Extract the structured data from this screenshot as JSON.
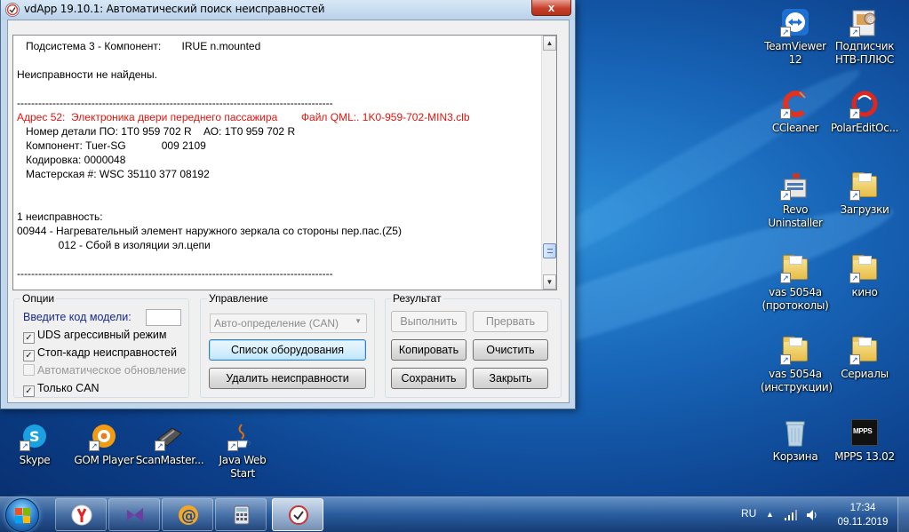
{
  "window": {
    "title": "vdApp 19.10.1: Автоматический поиск неисправностей",
    "close_label": "x"
  },
  "log": {
    "lines": [
      {
        "text": "   Подсистема 3 - Компонент:       IRUE n.mounted",
        "color": "black"
      },
      {
        "text": "",
        "color": "black"
      },
      {
        "text": "Неисправности не найдены.",
        "color": "black"
      },
      {
        "text": "",
        "color": "black"
      },
      {
        "text": "-----------------------------------------------------------------------------------------",
        "color": "black"
      },
      {
        "text": "Адрес 52:  Электроника двери переднего пассажира        Файл QML:. 1K0-959-702-MIN3.clb",
        "color": "red"
      },
      {
        "text": "   Номер детали ПО: 1T0 959 702 R    АО: 1T0 959 702 R",
        "color": "black"
      },
      {
        "text": "   Компонент: Tuer-SG            009 2109",
        "color": "black"
      },
      {
        "text": "   Кодировка: 0000048",
        "color": "black"
      },
      {
        "text": "   Мастерская #: WSC 35110 377 08192",
        "color": "black"
      },
      {
        "text": "",
        "color": "black"
      },
      {
        "text": "",
        "color": "black"
      },
      {
        "text": "1 неисправность:",
        "color": "black"
      },
      {
        "text": "00944 - Нагревательный элемент наружного зеркала со стороны пер.пас.(Z5)",
        "color": "black"
      },
      {
        "text": "              012 - Сбой в изоляции эл.цепи",
        "color": "black"
      },
      {
        "text": "",
        "color": "black"
      },
      {
        "text": "-----------------------------------------------------------------------------------------",
        "color": "black"
      }
    ]
  },
  "options": {
    "title": "Опции",
    "model_code_label": "Введите код модели:",
    "model_code_value": "",
    "checkboxes": [
      {
        "label": "UDS агрессивный режим",
        "checked": true,
        "enabled": true
      },
      {
        "label": "Стоп-кадр неисправностей",
        "checked": true,
        "enabled": true
      },
      {
        "label": "Автоматическое обновление",
        "checked": false,
        "enabled": false
      },
      {
        "label": "Только CAN",
        "checked": true,
        "enabled": true
      }
    ]
  },
  "control": {
    "title": "Управление",
    "mode_select": "Авто-определение (CAN)",
    "equipment_list_button": "Список оборудования",
    "delete_faults_button": "Удалить неисправности"
  },
  "result": {
    "title": "Результат",
    "execute_button": "Выполнить",
    "abort_button": "Прервать",
    "copy_button": "Копировать",
    "clear_button": "Очистить",
    "save_button": "Сохранить",
    "close_button": "Закрыть"
  },
  "desktop_icons": [
    {
      "name": "teamviewer",
      "label": "TeamViewer 12",
      "icon": "teamviewer-icon"
    },
    {
      "name": "podpisnik",
      "label": "Подписчик НТВ-ПЛЮС",
      "icon": "podpisnik-icon"
    },
    {
      "name": "ccleaner",
      "label": "CCleaner",
      "icon": "ccleaner-icon"
    },
    {
      "name": "polaredit",
      "label": "PolarEditOc...",
      "icon": "polaredit-icon"
    },
    {
      "name": "revo",
      "label": "Revo Uninstaller",
      "icon": "revo-icon"
    },
    {
      "name": "downloads",
      "label": "Загрузки",
      "icon": "folder-icon"
    },
    {
      "name": "vas-protocols",
      "label": "vas 5054a (протоколы)",
      "icon": "folder-icon"
    },
    {
      "name": "kino",
      "label": "кино",
      "icon": "folder-icon"
    },
    {
      "name": "vas-instructions",
      "label": "vas 5054a (инструкции)",
      "icon": "folder-icon"
    },
    {
      "name": "serials",
      "label": "Сериалы",
      "icon": "folder-icon"
    },
    {
      "name": "recycle-bin",
      "label": "Корзина",
      "icon": "recycle-bin-icon"
    },
    {
      "name": "mpps",
      "label": "MPPS 13.02",
      "icon": "mpps-icon"
    },
    {
      "name": "skype",
      "label": "Skype",
      "icon": "skype-icon"
    },
    {
      "name": "gom",
      "label": "GOM Player",
      "icon": "gom-player-icon"
    },
    {
      "name": "scanmaster",
      "label": "ScanMaster...",
      "icon": "scanmaster-icon"
    },
    {
      "name": "java",
      "label": "Java Web Start",
      "icon": "java-icon"
    }
  ],
  "mpps_icon_text": "MPPS",
  "taskbar": {
    "language": "RU",
    "time": "17:34",
    "date": "09.11.2019",
    "pinned": [
      "yandex-browser-icon",
      "visual-studio-icon",
      "mail-agent-icon",
      "calculator-icon",
      "vdapp-icon"
    ]
  },
  "colors": {
    "log_address_red": "#e5140c",
    "label_blue": "#1a2a8c",
    "close_button_red": "#c7402a"
  }
}
